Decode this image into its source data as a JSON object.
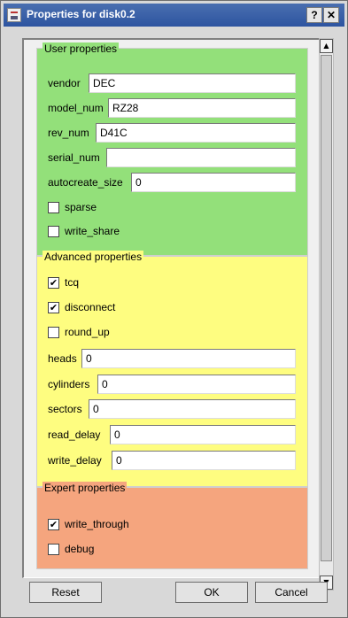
{
  "window": {
    "title": "Properties for disk0.2",
    "help_label": "?",
    "close_label": "✕"
  },
  "user": {
    "title": "User properties",
    "vendor": {
      "label": "vendor",
      "value": "DEC"
    },
    "model_num": {
      "label": "model_num",
      "value": "RZ28"
    },
    "rev_num": {
      "label": "rev_num",
      "value": "D41C"
    },
    "serial_num": {
      "label": "serial_num",
      "value": ""
    },
    "autocreate_size": {
      "label": "autocreate_size",
      "value": "0"
    },
    "sparse": {
      "label": "sparse",
      "checked": false
    },
    "write_share": {
      "label": "write_share",
      "checked": false
    }
  },
  "advanced": {
    "title": "Advanced properties",
    "tcq": {
      "label": "tcq",
      "checked": true,
      "mark": "✔"
    },
    "disconnect": {
      "label": "disconnect",
      "checked": true,
      "mark": "✔"
    },
    "round_up": {
      "label": "round_up",
      "checked": false
    },
    "heads": {
      "label": "heads",
      "value": "0"
    },
    "cylinders": {
      "label": "cylinders",
      "value": "0"
    },
    "sectors": {
      "label": "sectors",
      "value": "0"
    },
    "read_delay": {
      "label": "read_delay",
      "value": "0"
    },
    "write_delay": {
      "label": "write_delay",
      "value": "0"
    }
  },
  "expert": {
    "title": "Expert properties",
    "write_through": {
      "label": "write_through",
      "checked": true,
      "mark": "✔"
    },
    "debug": {
      "label": "debug",
      "checked": false
    }
  },
  "scroll": {
    "up_glyph": "▲",
    "down_glyph": "▼"
  },
  "buttons": {
    "reset": "Reset",
    "ok": "OK",
    "cancel": "Cancel"
  },
  "colors": {
    "title_bar": "#2d54a0",
    "user_group": "#93e07a",
    "advanced_group": "#fefd80",
    "expert_group": "#f5a57e"
  }
}
